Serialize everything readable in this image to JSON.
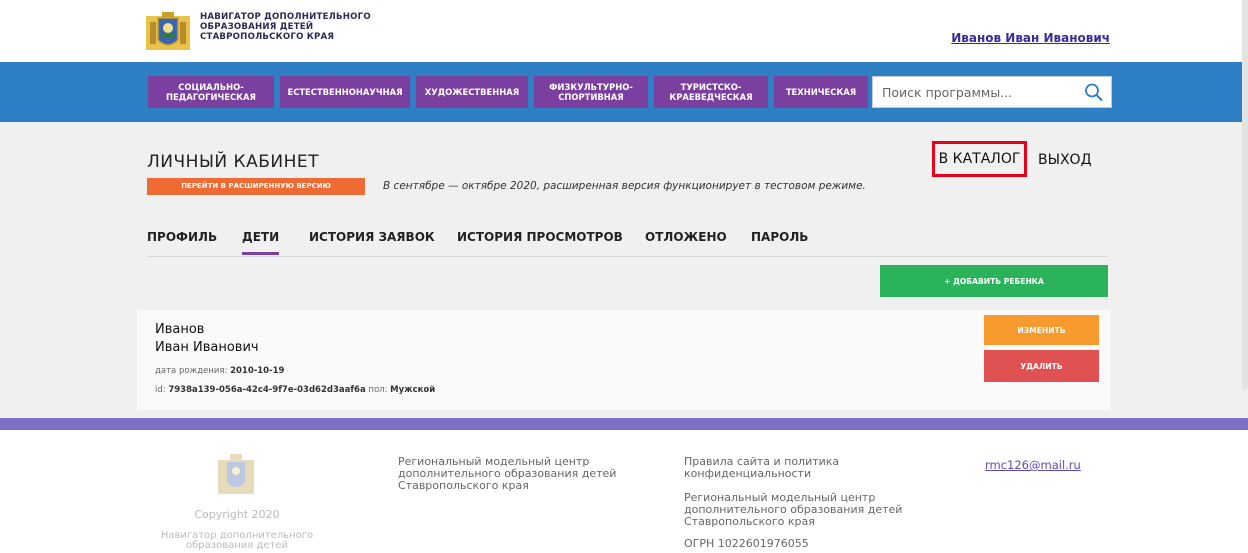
{
  "header": {
    "logo_lines": [
      "НАВИГАТОР ДОПОЛНИТЕЛЬНОГО",
      "ОБРАЗОВАНИЯ ДЕТЕЙ",
      "СТАВРОПОЛЬСКОГО КРАЯ"
    ],
    "user_name": "Иванов Иван Иванович"
  },
  "nav": {
    "items": [
      {
        "label": "СОЦИАЛЬНО-\nПЕДАГОГИЧЕСКАЯ"
      },
      {
        "label": "ЕСТЕСТВЕННОНАУЧНАЯ"
      },
      {
        "label": "ХУДОЖЕСТВЕННАЯ"
      },
      {
        "label": "ФИЗКУЛЬТУРНО-\nСПОРТИВНАЯ"
      },
      {
        "label": "ТУРИСТСКО-\nКРАЕВЕДЧЕСКАЯ"
      },
      {
        "label": "ТЕХНИЧЕСКАЯ"
      }
    ],
    "search_placeholder": "Поиск программы..."
  },
  "cabinet": {
    "title": "ЛИЧНЫЙ КАБИНЕТ",
    "extended_button": "ПЕРЕЙТИ В РАСШИРЕННУЮ ВЕРСИЮ",
    "notice": "В сентябре — октябре 2020, расширенная версия функционирует в тестовом режиме.",
    "catalog_link": "В КАТАЛОГ",
    "logout_link": "ВЫХОД"
  },
  "tabs": [
    {
      "label": "ПРОФИЛЬ",
      "active": false
    },
    {
      "label": "ДЕТИ",
      "active": true
    },
    {
      "label": "ИСТОРИЯ ЗАЯВОК",
      "active": false
    },
    {
      "label": "ИСТОРИЯ ПРОСМОТРОВ",
      "active": false
    },
    {
      "label": "ОТЛОЖЕНО",
      "active": false
    },
    {
      "label": "ПАРОЛЬ",
      "active": false
    }
  ],
  "add_child_button": "+ ДОБАВИТЬ РЕБЕНКА",
  "child": {
    "surname": "Иванов",
    "name": "Иван Иванович",
    "dob_label": "дата рождения: ",
    "dob_value": "2010-10-19",
    "id_label": "id: ",
    "id_value": "7938a139-056a-42c4-9f7e-03d62d3aaf6a",
    "gender_label": " пол: ",
    "gender_value": "Мужской",
    "edit_button": "ИЗМЕНИТЬ",
    "delete_button": "УДАЛИТЬ"
  },
  "footer": {
    "copyright": "Copyright 2020",
    "navigator_name": "Навигатор дополнительного образования детей",
    "center_name": "Региональный модельный центр дополнительного образования детей Ставропольского края",
    "rules_link": "Правила сайта и политика конфиденциальности",
    "center_name2": "Региональный модельный центр дополнительного образования детей Ставропольского края",
    "ogrn": "ОГРН 1022601976055",
    "email": "rmc126@mail.ru"
  },
  "colors": {
    "nav_bar": "#2f7fc4",
    "nav_item": "#7b3fa0",
    "extended_button": "#f06a34",
    "add_child": "#2bb35b",
    "edit": "#f89a2d",
    "delete": "#e05252",
    "highlight_box": "#e3001b"
  }
}
